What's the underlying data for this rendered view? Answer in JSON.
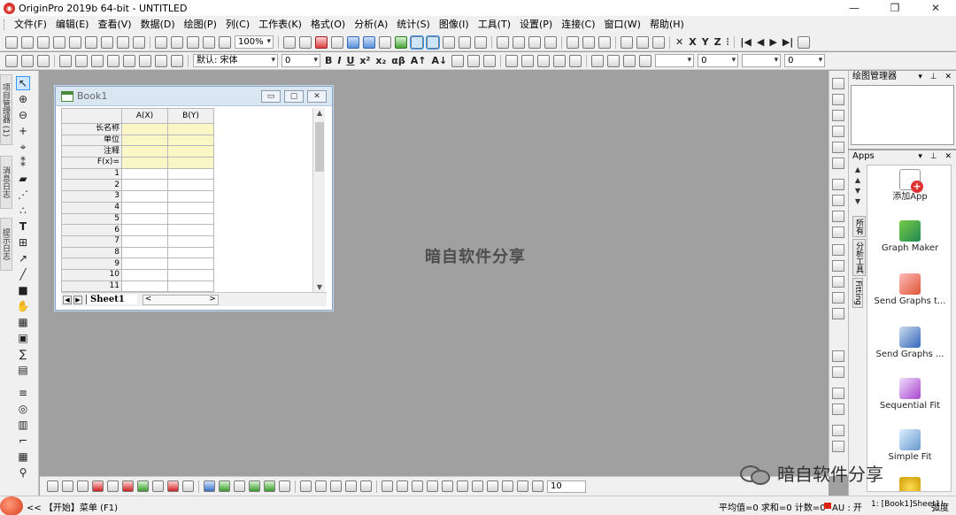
{
  "window": {
    "title": "OriginPro 2019b 64-bit - UNTITLED",
    "minimize": "—",
    "maximize": "❐",
    "close": "✕"
  },
  "menu": [
    "文件(F)",
    "编辑(E)",
    "查看(V)",
    "数据(D)",
    "绘图(P)",
    "列(C)",
    "工作表(K)",
    "格式(O)",
    "分析(A)",
    "统计(S)",
    "图像(I)",
    "工具(T)",
    "设置(P)",
    "连接(C)",
    "窗口(W)",
    "帮助(H)"
  ],
  "toolbar": {
    "zoom": "100%",
    "font_name": "默认: 宋体",
    "font_size": "0",
    "line_width": "0",
    "style_extra": "0"
  },
  "book": {
    "title": "Book1",
    "columns": [
      "A(X)",
      "B(Y)"
    ],
    "meta_rows": [
      "长名称",
      "单位",
      "注释",
      "F(x)="
    ],
    "rows": [
      "1",
      "2",
      "3",
      "4",
      "5",
      "6",
      "7",
      "8",
      "9",
      "10",
      "11"
    ],
    "sheet_tab": "Sheet1"
  },
  "workspace": {
    "watermark": "暗自软件分享"
  },
  "panels": {
    "plot_manager": {
      "title": "绘图管理器"
    },
    "apps": {
      "title": "Apps",
      "tabs": [
        "所有",
        "分析工具",
        "Fitting"
      ],
      "items": [
        {
          "label": "添加App",
          "icon": "add-app-icon",
          "color": "#d33"
        },
        {
          "label": "Graph Maker",
          "icon": "graph-maker-icon",
          "color": "#2a8"
        },
        {
          "label": "Send Graphs t...",
          "icon": "ppt-icon",
          "color": "#d75"
        },
        {
          "label": "Send Graphs ...",
          "icon": "word-icon",
          "color": "#36b"
        },
        {
          "label": "Sequential Fit",
          "icon": "sequential-fit-icon",
          "color": "#a4c"
        },
        {
          "label": "Simple Fit",
          "icon": "simple-fit-icon",
          "color": "#69c"
        }
      ]
    }
  },
  "bottom_toolbar": {
    "size_combo": "10"
  },
  "status": {
    "start_label": "<<  【开始】菜单 (F1)",
    "stats": "平均值=0 求和=0 计数=0",
    "au": "AU : 开",
    "sheet": "1: [Book1]Sheet1!",
    "angle": "弧度"
  },
  "overlay": {
    "wechat_name": "暗自软件分享"
  }
}
